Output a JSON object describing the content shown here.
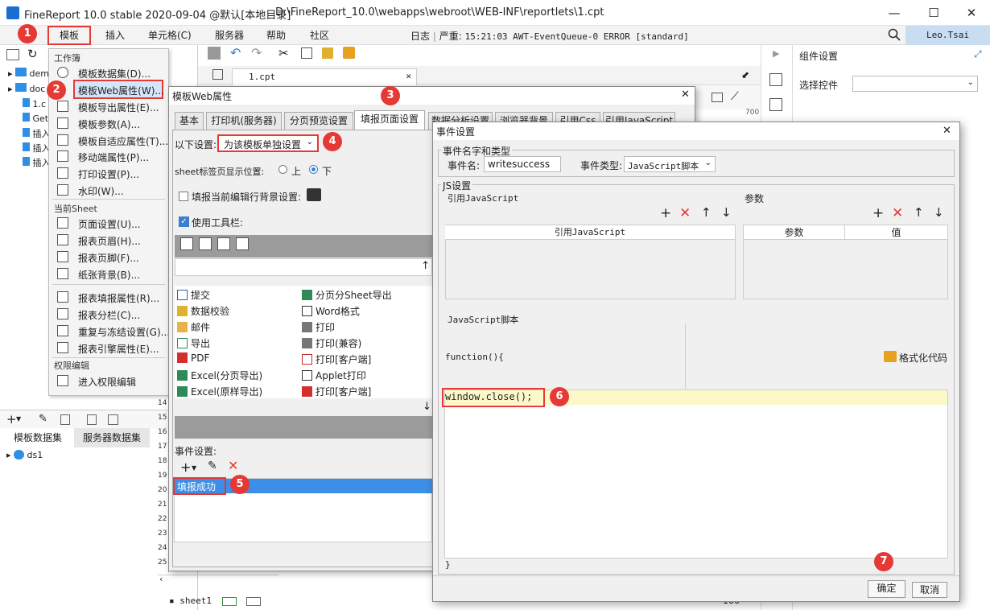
{
  "window": {
    "title": "FineReport 10.0 stable 2020-09-04 @默认[本地目录]",
    "path": "D:\\FineReport_10.0\\webapps\\webroot\\WEB-INF\\reportlets\\1.cpt",
    "minimize": "—",
    "maximize": "☐",
    "close": "✕"
  },
  "menu": {
    "template": "模板",
    "insert": "插入",
    "cell": "单元格(C)",
    "server": "服务器",
    "help": "帮助",
    "community": "社区"
  },
  "status": {
    "log": "日志",
    "severity": "严重:",
    "message": "15:21:03 AWT-EventQueue-0 ERROR [standard]"
  },
  "user": "Leo.Tsai",
  "tree": [
    "dem",
    "doc",
    "1.c",
    "Get",
    "插入",
    "插入",
    "插入"
  ],
  "template_menu": {
    "header_workbook": "工作簿",
    "dataset": "模板数据集(D)...",
    "web_attr": "模板Web属性(W)...",
    "export_attr": "模板导出属性(E)...",
    "params": "模板参数(A)...",
    "adaptive": "模板自适应属性(T)...",
    "mobile": "移动端属性(P)...",
    "print": "打印设置(P)...",
    "watermark": "水印(W)...",
    "header_sheet": "当前Sheet",
    "page_setup": "页面设置(U)...",
    "header": "报表页眉(H)...",
    "footer": "报表页脚(F)...",
    "paper_bg": "纸张背景(B)...",
    "fill_attr": "报表填报属性(R)...",
    "columns": "报表分栏(C)...",
    "freeze": "重复与冻结设置(G)...",
    "engine": "报表引擎属性(E)...",
    "header_perm": "权限编辑",
    "enter_perm": "进入权限编辑"
  },
  "bottom_tabs": {
    "template_ds": "模板数据集",
    "server_ds": "服务器数据集"
  },
  "ds_item": "ds1",
  "main": {
    "file_tab": "1.cpt",
    "sheet": "sheet1",
    "zoom": "100",
    "row_labels": [
      "14",
      "15",
      "16",
      "17",
      "18",
      "19",
      "20",
      "21",
      "22",
      "23",
      "24",
      "25"
    ],
    "ruler": "700"
  },
  "right_panel": {
    "title": "组件设置",
    "select_label": "选择控件"
  },
  "web_dialog": {
    "title": "模板Web属性",
    "tabs": [
      "基本",
      "打印机(服务器)",
      "分页预览设置",
      "填报页面设置",
      "数据分析设置",
      "浏览器背景",
      "引用Css",
      "引用JavaScript"
    ],
    "set_label": "以下设置:",
    "set_value": "为该模板单独设置",
    "sheet_pos_label": "sheet标签页显示位置:",
    "pos_up": "上",
    "pos_down": "下",
    "fill_bg_label": "填报当前编辑行背景设置:",
    "toolbar_label": "使用工具栏:",
    "tools": [
      [
        "提交",
        "分页分Sheet导出"
      ],
      [
        "数据校验",
        "Word格式"
      ],
      [
        "邮件",
        "打印"
      ],
      [
        "导出",
        "打印(兼容)"
      ],
      [
        "PDF",
        "打印[客户端]"
      ],
      [
        "Excel(分页导出)",
        "Applet打印"
      ],
      [
        "Excel(原样导出)",
        "打印[客户端]"
      ]
    ],
    "event_label": "事件设置:",
    "event_item": "填报成功"
  },
  "event_dialog": {
    "title": "事件设置",
    "group_name": "事件名字和类型",
    "name_label": "事件名:",
    "name_value": "writesuccess",
    "type_label": "事件类型:",
    "type_value": "JavaScript脚本",
    "js_group": "JS设置",
    "ref_js": "引用JavaScript",
    "params": "参数",
    "ref_js_col": "引用JavaScript",
    "param_col": "参数",
    "value_col": "值",
    "script_label": "JavaScript脚本",
    "func_open": "function(){",
    "format_code": "格式化代码",
    "code": "window.close();",
    "func_close": "}",
    "ok": "确定",
    "cancel": "取消"
  },
  "markers": [
    "1",
    "2",
    "3",
    "4",
    "5",
    "6",
    "7"
  ],
  "colors": {
    "accent": "#1b6fd0",
    "marker": "#e53935",
    "selection": "#3d8ee6",
    "code_highlight": "#fcf8c8",
    "user_bg": "#c9ddf2"
  }
}
